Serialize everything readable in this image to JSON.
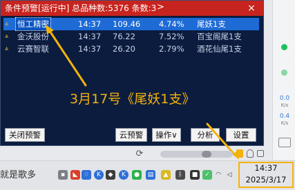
{
  "title_bar": {
    "text": "条件预警[运行中] 总品种数:5376 条数:3",
    "expand_glyph": ">",
    "close_glyph": "×",
    "bg_color": "#c8241f"
  },
  "alerts": [
    {
      "name": "恒工精密",
      "time": "14:37",
      "price": "109.46",
      "pct": "4.74%",
      "note": "尾妖1支",
      "selected": true
    },
    {
      "name": "金沃股份",
      "time": "14:37",
      "price": "76.22",
      "pct": "7.52%",
      "note": "百宝阁尾1支",
      "selected": false
    },
    {
      "name": "云赛智联",
      "time": "14:37",
      "price": "26.20",
      "pct": "2.79%",
      "note": "酒花仙尾1支",
      "selected": false
    }
  ],
  "caption": "3月17号《尾妖1支》",
  "buttons": {
    "close_alert": "关闭预警",
    "cloud_alert": "云预警",
    "operate": "操作∨",
    "analyze": "分析",
    "settings": "设置"
  },
  "side_panel": {
    "speed_up": "0.0",
    "speed_up_unit": "K/s",
    "speed_down": "0.4",
    "speed_down_unit": "K/s"
  },
  "taskbar": {
    "marquee": "就是歌多",
    "clock_time": "14:37",
    "clock_date": "2025/3/17"
  },
  "icons": [
    "alert-up-icon",
    "refresh-icon",
    "shield-icon",
    "wechat-icon",
    "k-app-icon",
    "bluetooth-icon",
    "wifi-icon",
    "volume-icon",
    "power-icon",
    "camera-icon",
    "mic-icon"
  ],
  "colors": {
    "accent_orange": "#f5b20a",
    "selection_blue": "#1e6bd6",
    "panel_navy": "#0b1c3f"
  }
}
